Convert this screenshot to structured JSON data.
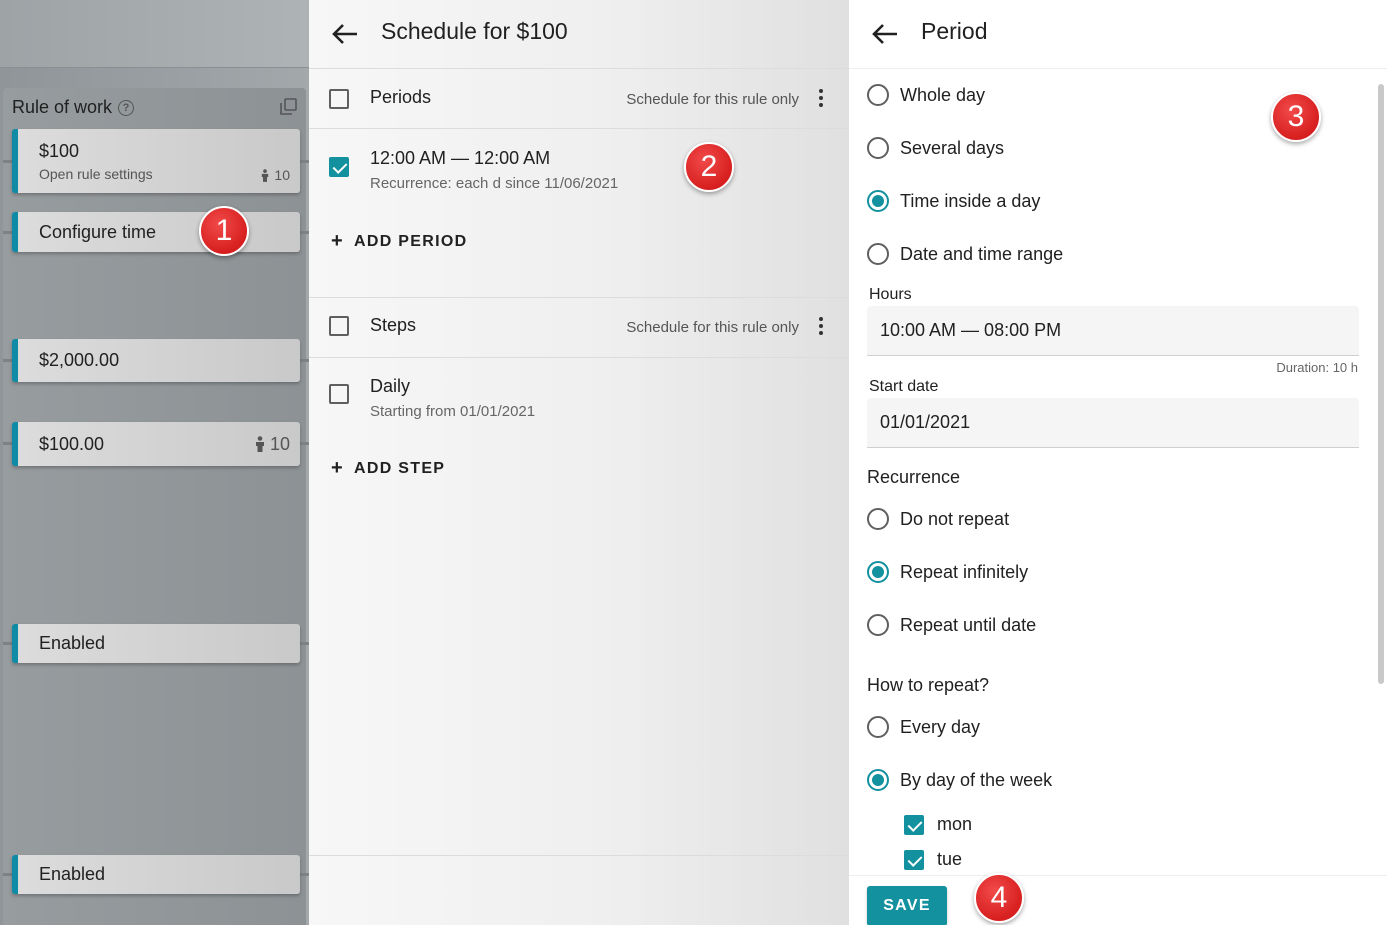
{
  "left": {
    "rule_title": "Rule of work",
    "cards": {
      "rule": {
        "title": "$100",
        "subtitle": "Open rule settings",
        "count": "10"
      },
      "configure": {
        "label": "Configure time"
      },
      "amount_2000": {
        "label": "$2,000.00"
      },
      "amount_100": {
        "label": "$100.00",
        "count": "10"
      },
      "enabled_1": {
        "label": "Enabled"
      },
      "enabled_2": {
        "label": "Enabled"
      }
    }
  },
  "middle": {
    "title": "Schedule for $100",
    "periods": {
      "label": "Periods",
      "meta": "Schedule for this rule only",
      "item_title": "12:00 AM — 12:00 AM",
      "item_sub": "Recurrence: each d since 11/06/2021",
      "item_checked": true,
      "add_label": "ADD PERIOD"
    },
    "steps": {
      "label": "Steps",
      "meta": "Schedule for this rule only",
      "item_title": "Daily",
      "item_sub": "Starting from 01/01/2021",
      "add_label": "ADD STEP"
    }
  },
  "right": {
    "title": "Period",
    "period_types": [
      "Whole day",
      "Several days",
      "Time inside a day",
      "Date and time range"
    ],
    "selected_period_type": "Time inside a day",
    "hours_label": "Hours",
    "hours_value": "10:00 AM — 08:00 PM",
    "duration": "Duration: 10 h",
    "start_date_label": "Start date",
    "start_date_value": "01/01/2021",
    "recurrence_label": "Recurrence",
    "recurrence_options": [
      "Do not repeat",
      "Repeat infinitely",
      "Repeat until date"
    ],
    "selected_recurrence": "Repeat infinitely",
    "how_label": "How to repeat?",
    "how_options": [
      "Every day",
      "By day of the week"
    ],
    "selected_how": "By day of the week",
    "weekdays": [
      {
        "label": "mon",
        "checked": true
      },
      {
        "label": "tue",
        "checked": true
      }
    ],
    "save_label": "SAVE"
  },
  "badges": [
    "1",
    "2",
    "3",
    "4"
  ],
  "colors": {
    "accent": "#13919f",
    "badge": "#d71f1f",
    "card_stripe": "#0f8ba6"
  }
}
